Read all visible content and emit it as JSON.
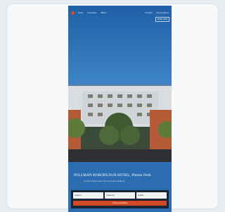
{
  "header": {
    "nav": [
      "Hotel",
      "Amenities",
      "Offers"
    ],
    "right": [
      "Contact",
      "Reservations"
    ],
    "book_chip": "BOOK NOW"
  },
  "hero": {
    "title": "PULLMAN BOROBUDUR HOTEL, Phnom Penh",
    "subtitle": "A modern 5-star hotel in the heart of the capital city"
  },
  "booking": {
    "fields": [
      "Check-in",
      "Check-out",
      "Guests"
    ],
    "cta": "Check availability"
  },
  "colors": {
    "sky": "#2b6db0",
    "accent": "#d14a25",
    "card": "#f8f9fb"
  }
}
